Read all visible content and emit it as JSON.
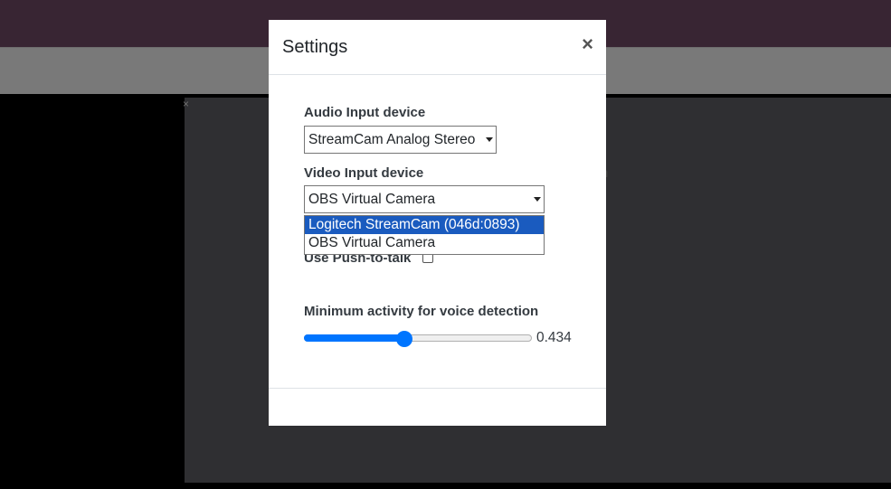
{
  "modal": {
    "title": "Settings",
    "close_label": "×"
  },
  "audio": {
    "label": "Audio Input device",
    "selected": "StreamCam Analog Stereo"
  },
  "video": {
    "label": "Video Input device",
    "selected": "OBS Virtual Camera",
    "options": [
      {
        "label": "Logitech StreamCam (046d:0893)",
        "highlighted": true
      },
      {
        "label": "OBS Virtual Camera",
        "highlighted": false
      }
    ]
  },
  "push_to_talk": {
    "label": "Use Push-to-talk",
    "checked": false
  },
  "voice_detection": {
    "label": "Minimum activity for voice detection",
    "value": "0.434",
    "fraction": 0.434
  },
  "background": {
    "call_close_label": "×",
    "hint_text": "n"
  },
  "colors": {
    "topbar": "#714b67",
    "accent": "#0075ff",
    "option_highlight": "#1a5bbf"
  }
}
